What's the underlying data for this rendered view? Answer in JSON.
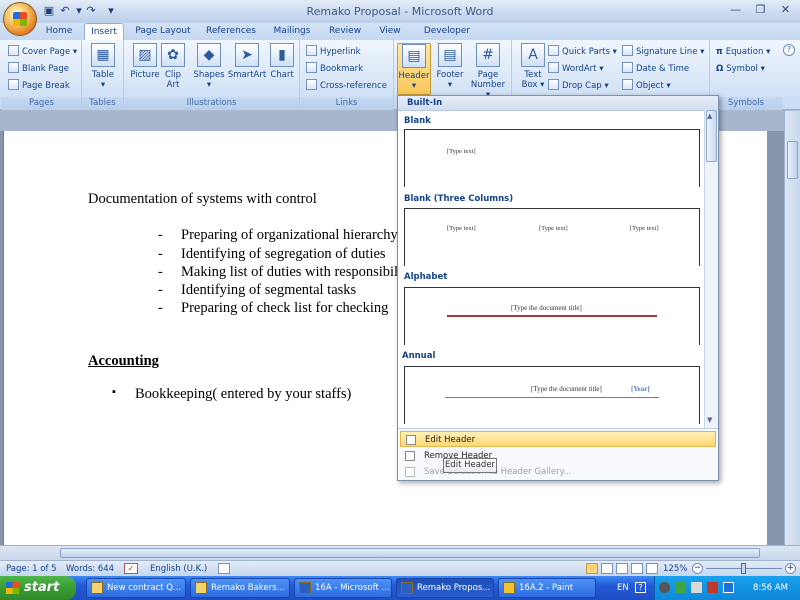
{
  "window": {
    "title": "Remako Proposal - Microsoft Word"
  },
  "qat": {
    "icons": [
      "save-icon",
      "undo-icon",
      "redo-icon",
      "customize-icon"
    ]
  },
  "tabs": [
    "Home",
    "Insert",
    "Page Layout",
    "References",
    "Mailings",
    "Review",
    "View",
    "Developer"
  ],
  "active_tab": "Insert",
  "ribbon": {
    "pages": {
      "label": "Pages",
      "items": [
        "Cover Page",
        "Blank Page",
        "Page Break"
      ]
    },
    "tables": {
      "label": "Tables",
      "table": "Table"
    },
    "illustrations": {
      "label": "Illustrations",
      "picture": "Picture",
      "clip1": "Clip",
      "clip2": "Art",
      "shapes": "Shapes",
      "smartart": "SmartArt",
      "chart": "Chart"
    },
    "links": {
      "label": "Links",
      "items": [
        "Hyperlink",
        "Bookmark",
        "Cross-reference"
      ]
    },
    "header_footer": {
      "header": "Header",
      "footer": "Footer",
      "page1": "Page",
      "page2": "Number"
    },
    "text": {
      "textbox1": "Text",
      "textbox2": "Box",
      "items": [
        "Quick Parts",
        "WordArt",
        "Drop Cap"
      ],
      "items2": [
        "Signature Line",
        "Date & Time",
        "Object"
      ]
    },
    "symbols": {
      "label": "Symbols",
      "equation": "Equation",
      "symbol": "Symbol"
    }
  },
  "document": {
    "heading": "Documentation of systems with control",
    "bullets": [
      "Preparing of organizational hierarchy",
      "Identifying of segregation of duties",
      "Making list of duties with responsibilities",
      "Identifying of  segmental tasks",
      "Preparing of check list for checking"
    ],
    "bullet_marker": "-",
    "accounting_heading": "Accounting",
    "accounting_bullet": "Bookkeeping( entered by your staffs)",
    "accounting_marker": "▪"
  },
  "gallery": {
    "header": "Built-In",
    "categories": [
      {
        "name": "Blank",
        "preview": [
          "[Type text]"
        ]
      },
      {
        "name": "Blank (Three Columns)",
        "preview": [
          "[Type text]",
          "[Type text]",
          "[Type text]"
        ]
      },
      {
        "name": "Alphabet",
        "preview": [
          "[Type the document title]"
        ]
      },
      {
        "name": "Annual",
        "preview": [
          "[Type the document title]",
          "[Year]"
        ]
      }
    ],
    "menu": [
      "Edit Header",
      "Remove Header",
      "Save Selection to Header Gallery..."
    ],
    "tooltip": "Edit Header"
  },
  "status": {
    "page": "Page: 1 of 5",
    "words": "Words: 644",
    "language": "English (U.K.)",
    "zoom": "125%"
  },
  "taskbar": {
    "start": "start",
    "tasks": [
      "New contract Q...",
      "Remako Bakers...",
      "16A - Microsoft ...",
      "Remako Propos...",
      "16A.2 - Paint"
    ],
    "active_task_index": 3,
    "lang": "EN",
    "time": "8:56 AM"
  },
  "colors": {
    "accent": "#15428b",
    "highlight": "#fcd877",
    "title_red": "#a33a3a",
    "year_blue": "#5b7fb8"
  }
}
